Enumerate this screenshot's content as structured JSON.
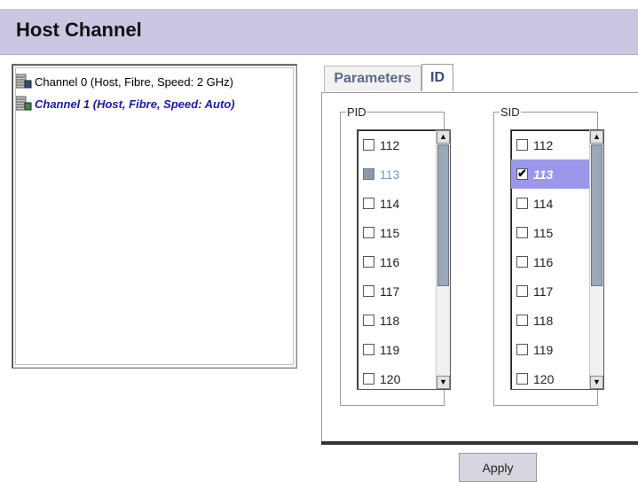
{
  "header": {
    "title": "Host Channel"
  },
  "tree": {
    "nodes": [
      {
        "label": "Channel 0 (Host, Fibre, Speed: 2 GHz)",
        "selected": false
      },
      {
        "label": "Channel 1 (Host, Fibre, Speed: Auto)",
        "selected": true
      }
    ]
  },
  "tabs": [
    {
      "label": "Parameters",
      "active": false
    },
    {
      "label": "ID",
      "active": true
    }
  ],
  "pid": {
    "legend": "PID",
    "items": [
      {
        "label": "112",
        "checked": false,
        "state": "normal"
      },
      {
        "label": "113",
        "checked": false,
        "state": "disabled"
      },
      {
        "label": "114",
        "checked": false,
        "state": "normal"
      },
      {
        "label": "115",
        "checked": false,
        "state": "normal"
      },
      {
        "label": "116",
        "checked": false,
        "state": "normal"
      },
      {
        "label": "117",
        "checked": false,
        "state": "normal"
      },
      {
        "label": "118",
        "checked": false,
        "state": "normal"
      },
      {
        "label": "119",
        "checked": false,
        "state": "normal"
      },
      {
        "label": "120",
        "checked": false,
        "state": "normal"
      }
    ]
  },
  "sid": {
    "legend": "SID",
    "items": [
      {
        "label": "112",
        "checked": false,
        "state": "normal"
      },
      {
        "label": "113",
        "checked": true,
        "state": "selected"
      },
      {
        "label": "114",
        "checked": false,
        "state": "normal"
      },
      {
        "label": "115",
        "checked": false,
        "state": "normal"
      },
      {
        "label": "116",
        "checked": false,
        "state": "normal"
      },
      {
        "label": "117",
        "checked": false,
        "state": "normal"
      },
      {
        "label": "118",
        "checked": false,
        "state": "normal"
      },
      {
        "label": "119",
        "checked": false,
        "state": "normal"
      },
      {
        "label": "120",
        "checked": false,
        "state": "normal"
      }
    ]
  },
  "apply_label": "Apply",
  "colors": {
    "header_bg": "#c9c7e2",
    "selected_item_bg": "#9b98ec",
    "tree_selected_text": "#1a1aa8"
  }
}
